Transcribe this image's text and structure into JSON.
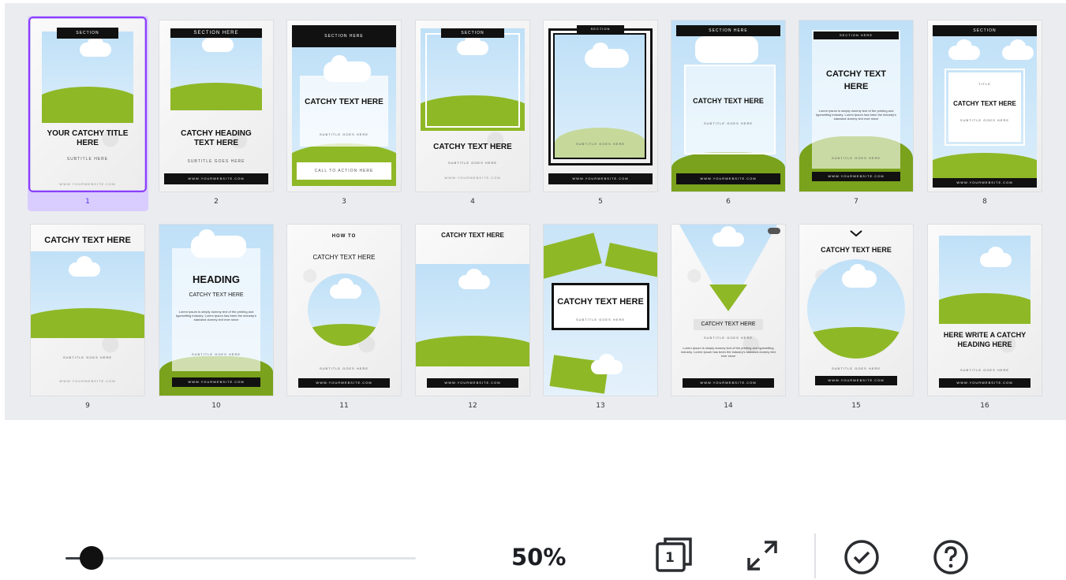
{
  "pages": [
    {
      "number": "1",
      "title": "YOUR CATCHY TITLE HERE",
      "subtitle": "SUBTITLE HERE",
      "bar": "SECTION",
      "footer": "WWW.YOURWEBSITE.COM"
    },
    {
      "number": "2",
      "title": "CATCHY HEADING TEXT HERE",
      "subtitle": "SUBTITLE GOES HERE",
      "bar": "SECTION HERE",
      "footer": "WWW.YOURWEBSITE.COM"
    },
    {
      "number": "3",
      "title": "CATCHY TEXT HERE",
      "subtitle": "SUBTITLE GOES HERE",
      "bar": "SECTION HERE",
      "cta": "CALL TO ACTION HERE"
    },
    {
      "number": "4",
      "title": "CATCHY TEXT HERE",
      "subtitle": "SUBTITLE GOES HERE",
      "bar": "SECTION",
      "footer": "WWW.YOURWEBSITE.COM"
    },
    {
      "number": "5",
      "subtitle": "SUBTITLE GOES HERE",
      "bar": "SECTION",
      "footer": "WWW.YOURWEBSITE.COM"
    },
    {
      "number": "6",
      "title": "CATCHY TEXT HERE",
      "subtitle": "SUBTITLE GOES HERE",
      "bar": "SECTION HERE",
      "footer": "WWW.YOURWEBSITE.COM"
    },
    {
      "number": "7",
      "title": "CATCHY TEXT HERE",
      "subtitle": "SUBTITLE GOES HERE",
      "bar": "SECTION HERE",
      "footer": "WWW.YOURWEBSITE.COM",
      "body": "Lorem Ipsum is simply dummy text of the printing and typesetting industry. Lorem Ipsum has been the industry's standard dummy text ever since"
    },
    {
      "number": "8",
      "title": "CATCHY TEXT HERE",
      "subtitle": "SUBTITLE GOES HERE",
      "bar": "SECTION",
      "small": "TITLE",
      "footer": "WWW.YOURWEBSITE.COM"
    },
    {
      "number": "9",
      "title": "CATCHY TEXT HERE",
      "subtitle": "SUBTITLE GOES HERE",
      "footer": "WWW.YOURWEBSITE.COM"
    },
    {
      "number": "10",
      "title": "HEADING",
      "subtitle2": "CATCHY TEXT HERE",
      "subtitle": "SUBTITLE GOES HERE",
      "footer": "WWW.YOURWEBSITE.COM",
      "body": "Lorem Ipsum is simply dummy text of the printing and typesetting industry. Lorem Ipsum has been the industry's standard dummy text ever since"
    },
    {
      "number": "11",
      "small": "HOW TO",
      "title": "CATCHY TEXT HERE",
      "subtitle": "SUBTITLE GOES HERE",
      "footer": "WWW.YOURWEBSITE.COM"
    },
    {
      "number": "12",
      "title": "CATCHY TEXT HERE",
      "footer": "WWW.YOURWEBSITE.COM"
    },
    {
      "number": "13",
      "title": "CATCHY TEXT HERE",
      "subtitle": "SUBTITLE GOES HERE"
    },
    {
      "number": "14",
      "title": "CATCHY TEXT HERE",
      "subtitle": "SUBTITLE GOES HERE",
      "footer": "WWW.YOURWEBSITE.COM",
      "body": "Lorem Ipsum is simply dummy text of the printing and typesetting industry. Lorem Ipsum has been the industry's standard dummy text ever since"
    },
    {
      "number": "15",
      "title": "CATCHY TEXT HERE",
      "subtitle": "SUBTITLE GOES HERE",
      "footer": "WWW.YOURWEBSITE.COM"
    },
    {
      "number": "16",
      "title": "HERE WRITE A CATCHY HEADING HERE",
      "subtitle": "SUBTITLE GOES HERE",
      "footer": "WWW.YOURWEBSITE.COM"
    }
  ],
  "toolbar": {
    "zoom_label": "50%",
    "zoom_value": 0.5,
    "page_count_label": "1",
    "icons": [
      "page-count-icon",
      "expand-icon",
      "check-circle-icon",
      "help-icon"
    ]
  },
  "colors": {
    "accent": "#8b3dff",
    "green": "#7aa21c",
    "dark": "#111111"
  }
}
